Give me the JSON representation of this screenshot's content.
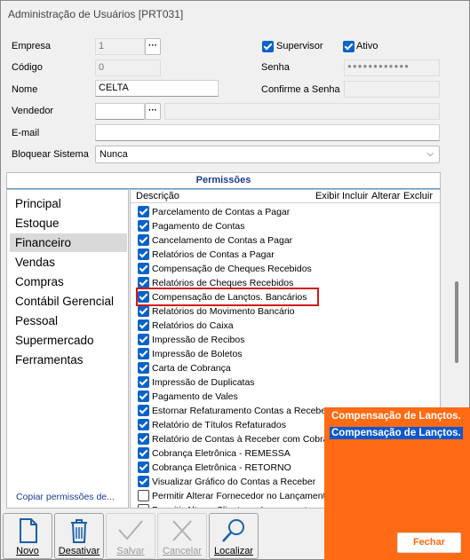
{
  "window": {
    "title": "Administração de Usuários [PRT031]"
  },
  "form": {
    "empresa_label": "Empresa",
    "empresa_value": "1",
    "codigo_label": "Código",
    "codigo_value": "0",
    "nome_label": "Nome",
    "nome_value": "CELTA",
    "vendedor_label": "Vendedor",
    "vendedor_value": "",
    "email_label": "E-mail",
    "email_value": "",
    "bloquear_label": "Bloquear Sistema",
    "bloquear_value": "Nunca",
    "supervisor_label": "Supervisor",
    "supervisor_checked": true,
    "ativo_label": "Ativo",
    "ativo_checked": true,
    "senha_label": "Senha",
    "confirme_label": "Confirme a Senha"
  },
  "permissions": {
    "title": "Permissões",
    "nav": [
      "Principal",
      "Estoque",
      "Financeiro",
      "Vendas",
      "Compras",
      "Contábil Gerencial",
      "Pessoal",
      "Supermercado",
      "Ferramentas"
    ],
    "selected_nav": "Financeiro",
    "copy_link": "Copiar permissões de...",
    "columns": {
      "descricao": "Descrição",
      "exibir": "Exibir",
      "incluir": "Incluir",
      "alterar": "Alterar",
      "excluir": "Excluir"
    },
    "rows": [
      {
        "label": "Parcelamento de Contas a Pagar",
        "checked": true
      },
      {
        "label": "Pagamento de Contas",
        "checked": true
      },
      {
        "label": "Cancelamento de Contas a Pagar",
        "checked": true
      },
      {
        "label": "Relatórios de Contas a Pagar",
        "checked": true
      },
      {
        "label": "Compensação de Cheques Recebidos",
        "checked": true
      },
      {
        "label": "Relatórios de Cheques Recebidos",
        "checked": true
      },
      {
        "label": "Compensação de Lançtos. Bancários",
        "checked": true
      },
      {
        "label": "Relatórios do Movimento Bancário",
        "checked": true
      },
      {
        "label": "Relatórios do Caixa",
        "checked": true
      },
      {
        "label": "Impressão de Recibos",
        "checked": true
      },
      {
        "label": "Impressão de Boletos",
        "checked": true
      },
      {
        "label": "Carta de Cobrança",
        "checked": true
      },
      {
        "label": "Impressão de Duplicatas",
        "checked": true
      },
      {
        "label": "Pagamento de Vales",
        "checked": true
      },
      {
        "label": "Estornar Refaturamento Contas a Receber",
        "checked": true
      },
      {
        "label": "Relatório de Títulos Refaturados",
        "checked": true
      },
      {
        "label": "Relatório de Contas à Receber com Cobrança",
        "checked": true
      },
      {
        "label": "Cobrança Eletrônica - REMESSA",
        "checked": true
      },
      {
        "label": "Cobrança Eletrônica - RETORNO",
        "checked": true
      },
      {
        "label": "Visualizar Gráfico do Contas a Receber",
        "checked": true
      },
      {
        "label": "Permitir Alterar Fornecedor no Lançamento",
        "checked": false
      },
      {
        "label": "Permitir Alterar Cliente no Lançamento",
        "checked": false
      }
    ]
  },
  "toolbar": {
    "novo": "Novo",
    "desativar": "Desativar",
    "salvar": "Salvar",
    "cancelar": "Cancelar",
    "localizar": "Localizar"
  },
  "popup": {
    "line1": "Compensação de Lançtos.",
    "line2": "Compensação de Lançtos.",
    "close": "Fechar",
    "color": "#ff6a14"
  }
}
